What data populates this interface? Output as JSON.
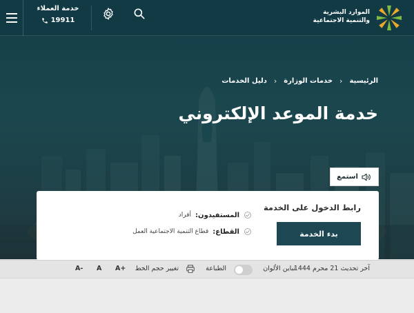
{
  "header": {
    "logo_line1": "الموارد البشرية",
    "logo_line2": "والتنمية الاجتماعية",
    "customer_service_title": "خدمة العملاء",
    "customer_service_phone": "19911"
  },
  "breadcrumb": {
    "items": [
      "الرئيسية",
      "خدمات الوزارة",
      "دليل الخدمات"
    ]
  },
  "page_title": "خدمة الموعد الإلكتروني",
  "listen_label": "استمع",
  "card": {
    "link_title": "رابط الدخول على الخدمة",
    "start_button": "بدء الخدمة",
    "beneficiaries_label": "المستفيدون:",
    "beneficiaries_value": "أفراد",
    "sector_label": "القطاع:",
    "sector_value": "قطاع التنمية الاجتماعية  العمل"
  },
  "toolbar": {
    "last_updated": "آخر تحديث 21 محرم 1444",
    "color_contrast": "تباين الألوان",
    "print": "الطباعة",
    "font_size": "تغيير حجم الخط",
    "font_increase": "A+",
    "font_reset": "A",
    "font_decrease": "A-"
  },
  "colors": {
    "primary": "#1d4753",
    "header_bg": "#103a44",
    "logo_green": "#7dbb42",
    "logo_gold": "#e9a92b"
  },
  "icons": [
    "menu-icon",
    "phone-icon",
    "gear-icon",
    "search-icon",
    "speaker-icon",
    "check-icon",
    "printer-icon"
  ]
}
